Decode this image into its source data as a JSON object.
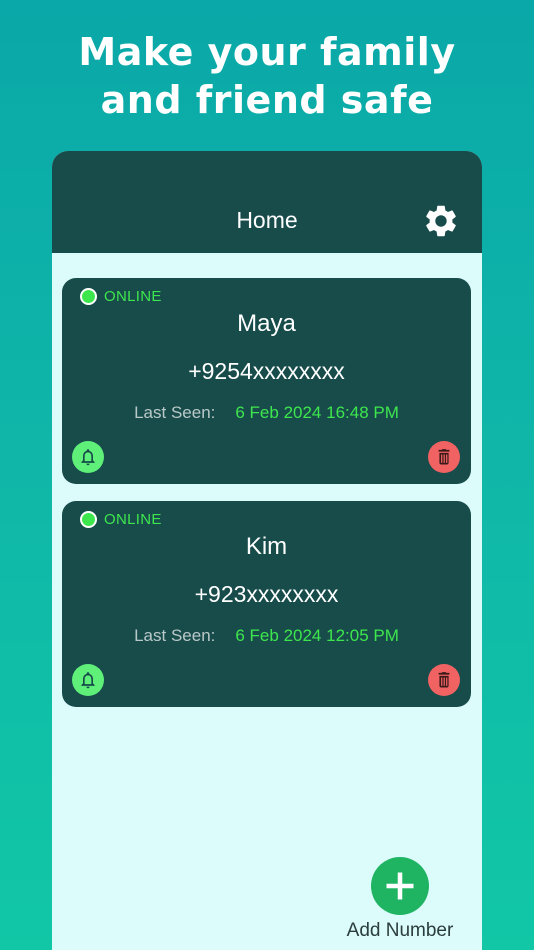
{
  "promo": {
    "line1": "Make your family",
    "line2": "and friend safe"
  },
  "app_bar": {
    "title": "Home",
    "settings_icon": "gear-icon"
  },
  "contacts": [
    {
      "status": "ONLINE",
      "name": "Maya",
      "phone": "+9254xxxxxxxx",
      "last_seen_label": "Last Seen:",
      "last_seen_value": "6 Feb 2024 16:48 PM"
    },
    {
      "status": "ONLINE",
      "name": "Kim",
      "phone": "+923xxxxxxxx",
      "last_seen_label": "Last Seen:",
      "last_seen_value": "6 Feb 2024 12:05 PM"
    }
  ],
  "fab": {
    "label": "Add Number",
    "icon": "plus-icon"
  },
  "colors": {
    "background_top": "#0aa8a8",
    "background_bottom": "#11c7a6",
    "app_bar": "#174c4b",
    "card": "#174c4b",
    "online": "#3ee64d",
    "bell_button": "#5ff07a",
    "delete_button": "#f16262",
    "fab": "#1fb462",
    "screen": "#dcfbfb"
  }
}
